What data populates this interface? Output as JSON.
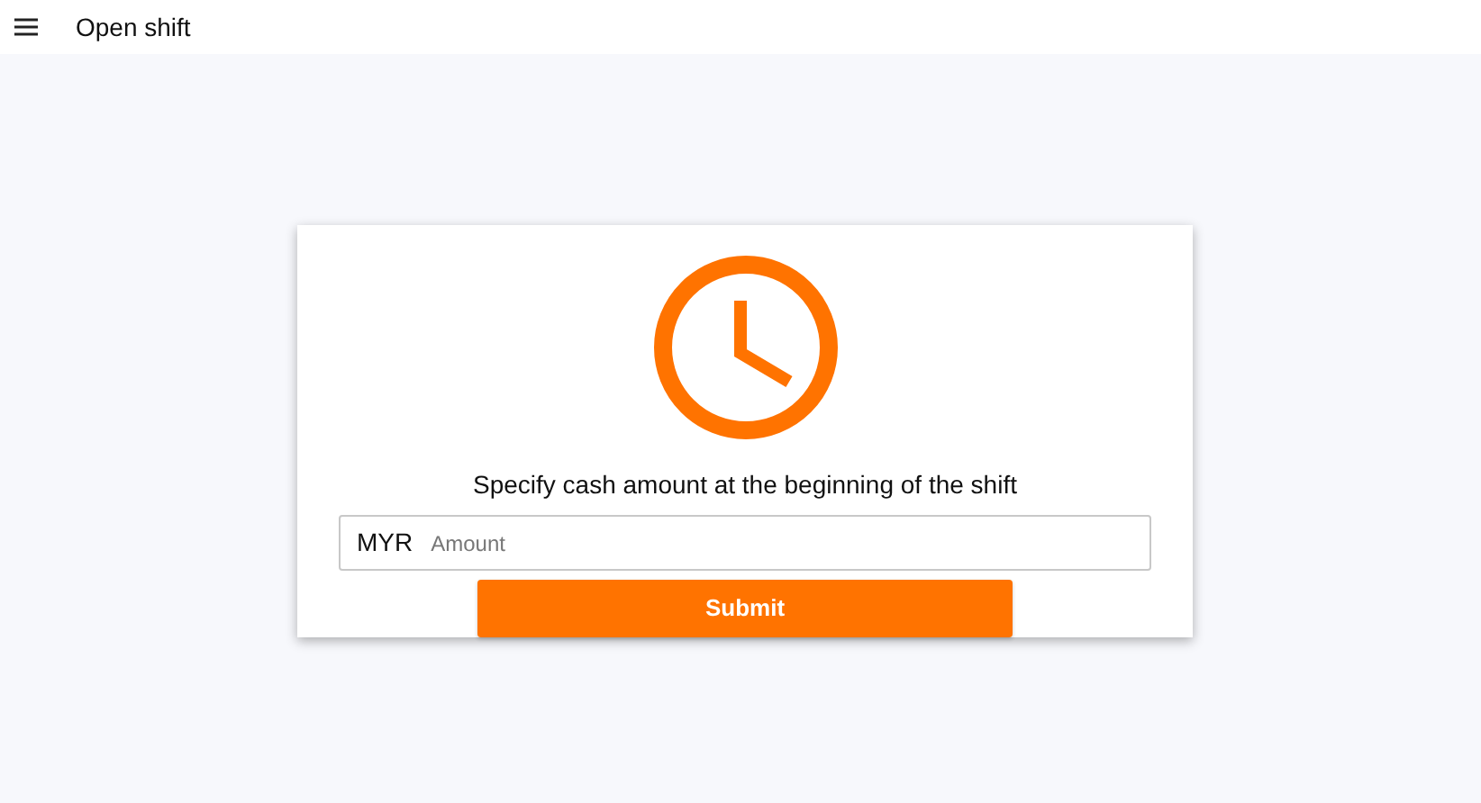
{
  "header": {
    "title": "Open shift"
  },
  "card": {
    "prompt": "Specify cash amount at the beginning of the shift",
    "field": {
      "prefix": "MYR",
      "placeholder": "Amount"
    },
    "button": "Submit"
  }
}
